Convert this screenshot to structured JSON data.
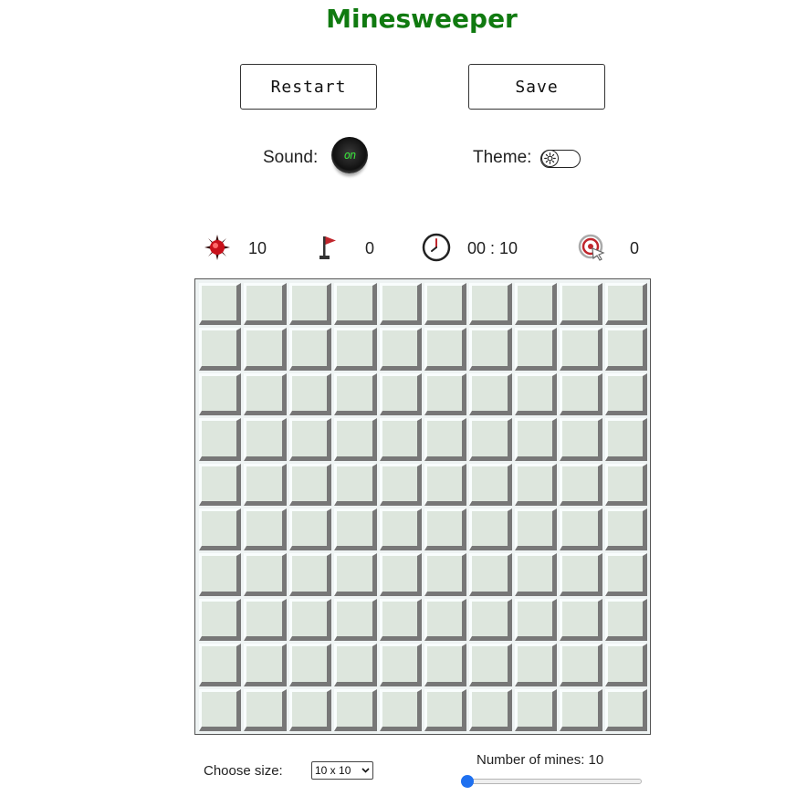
{
  "title": "Minesweeper",
  "buttons": {
    "restart": "Restart",
    "save": "Save"
  },
  "options": {
    "sound_label": "Sound:",
    "sound_display": "on",
    "theme_label": "Theme:"
  },
  "stats": {
    "mines": "10",
    "flags": "0",
    "timer": "00 : 10",
    "clicks": "0"
  },
  "board": {
    "rows": 10,
    "cols": 10
  },
  "controls": {
    "size_label": "Choose size:",
    "size_selected": "10 x 10",
    "mines_label": "Number of mines: 10",
    "mines_slider_fraction": 0
  },
  "colors": {
    "title": "#107a10",
    "cell_face": "#dde6dd",
    "cell_shadow": "#777777",
    "slider_thumb": "#1e70f0"
  }
}
